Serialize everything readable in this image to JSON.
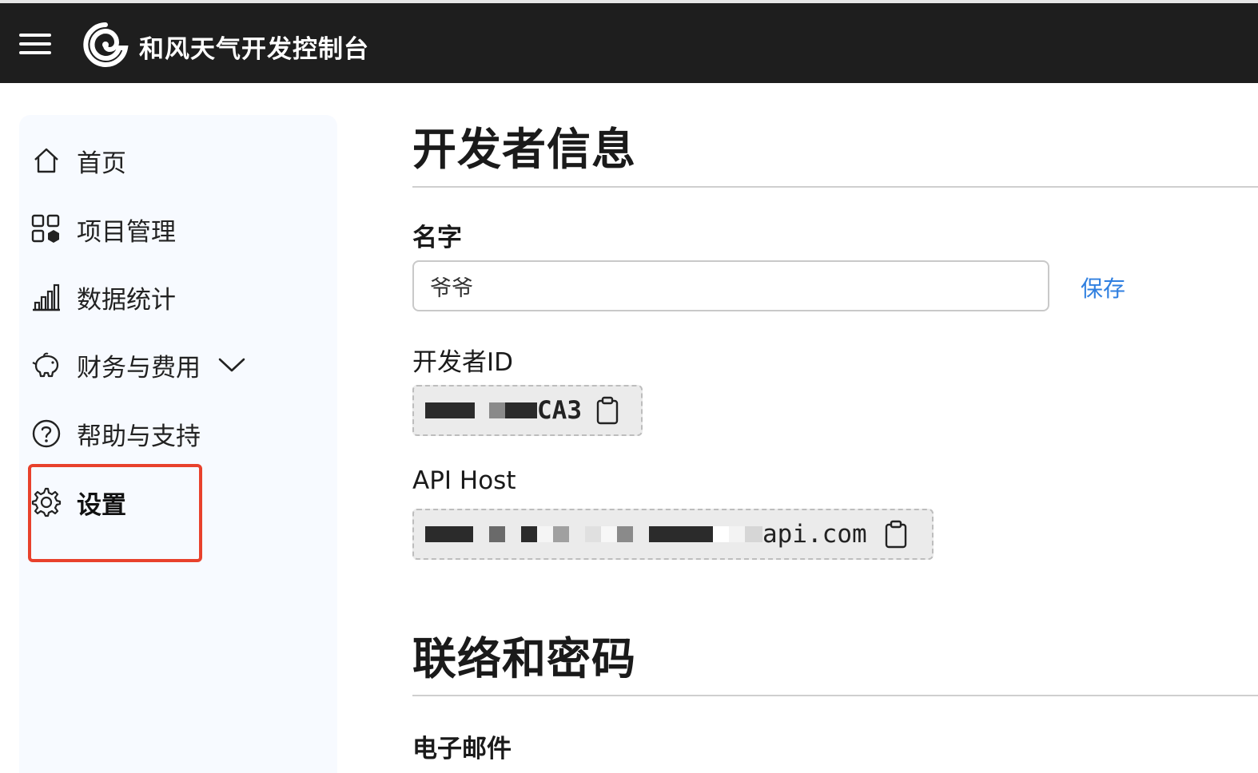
{
  "header": {
    "title": "和风天气开发控制台",
    "menu_icon": "hamburger-menu-icon",
    "logo_icon": "qweather-logo-icon",
    "background": "#1e1e1e"
  },
  "sidebar": {
    "items": [
      {
        "label": "首页",
        "icon": "home-icon"
      },
      {
        "label": "项目管理",
        "icon": "apps-grid-icon"
      },
      {
        "label": "数据统计",
        "icon": "bar-chart-icon"
      },
      {
        "label": "财务与费用",
        "icon": "piggy-bank-icon",
        "expand_icon": "chevron-down-icon"
      },
      {
        "label": "帮助与支持",
        "icon": "help-circle-icon"
      },
      {
        "label": "设置",
        "icon": "gear-icon",
        "active": true
      }
    ],
    "highlight_color": "#e8412c"
  },
  "main": {
    "section1_title": "开发者信息",
    "name_label": "名字",
    "name_value": "爷爷",
    "save_label": "保存",
    "dev_id_label": "开发者ID",
    "dev_id_visible": "CA3",
    "api_host_label": "API Host",
    "api_host_visible": "api.com",
    "section2_title": "联络和密码",
    "email_label": "电子邮件",
    "accent_color": "#2f7fe0"
  }
}
